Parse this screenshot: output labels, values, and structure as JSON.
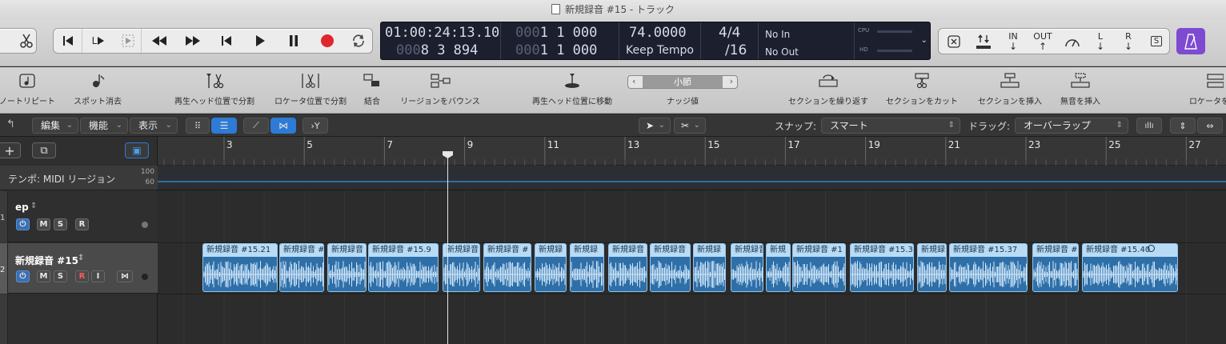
{
  "window_title": "新規録音 #15 - トラック",
  "transport": {
    "lcd": {
      "time_main": "01:00:24:13.10",
      "bars_left_dim": "000",
      "bars_left": "8 3 894",
      "pos1_dim": "000",
      "pos1": "1  1  000",
      "pos2_dim": "000",
      "pos2": "1  1  000",
      "tempo": "74.0000",
      "tempo_mode": "Keep Tempo",
      "sig_top": "4/4",
      "sig_bottom": "/16",
      "in_label": "No In",
      "out_label": "No Out",
      "cpu_label": "CPU",
      "hd_label": "HD"
    },
    "l_label": "L"
  },
  "right_controls": {
    "in_label": "IN",
    "out_label": "OUT",
    "l_label": "L",
    "r_label": "R",
    "s_label": "S"
  },
  "tools": [
    {
      "label": "ノートリピート"
    },
    {
      "label": "スポット消去"
    },
    {
      "label": "再生ヘッド位置で分割"
    },
    {
      "label": "ロケータ位置で分割"
    },
    {
      "label": "結合"
    },
    {
      "label": "リージョンをバウンス"
    },
    {
      "label": "再生ヘッド位置に移動"
    },
    {
      "label": "ナッジ値"
    },
    {
      "label": "セクションを繰り返す"
    },
    {
      "label": "セクションをカット"
    },
    {
      "label": "セクションを挿入"
    },
    {
      "label": "無音を挿入"
    },
    {
      "label": "ロケータを"
    }
  ],
  "nudge": {
    "value": "小節"
  },
  "editbar": {
    "edit_menu": "編集",
    "function_menu": "機能",
    "view_menu": "表示",
    "snap_label": "スナップ:",
    "snap_value": "スマート",
    "drag_label": "ドラッグ:",
    "drag_value": "オーバーラップ"
  },
  "ruler": {
    "bars": [
      "3",
      "5",
      "7",
      "9",
      "11",
      "13",
      "15",
      "17",
      "19",
      "21",
      "23",
      "25",
      "27"
    ]
  },
  "tempo_lane": {
    "label": "テンポ: MIDI リージョン",
    "max": "100",
    "min": "60"
  },
  "tracks": [
    {
      "number": "1",
      "name": "ep",
      "m": "M",
      "s": "S",
      "r": "R"
    },
    {
      "number": "2",
      "name": "新規録音 #15",
      "m": "M",
      "s": "S",
      "r": "R",
      "i": "I"
    }
  ],
  "regions": [
    "新規録音 #15.21",
    "新規録音 #",
    "新規録音",
    "新規録音 #15.9",
    "新規録音",
    "新規録音 #",
    "新規録",
    "新規録",
    "新規録音",
    "新規録音",
    "新規録",
    "新規録音",
    "新規",
    "新規録音 #1",
    "新規録音 #15.3",
    "新規録",
    "新規録音 #15.37",
    "新規録音 #",
    "新規録音 #15.40"
  ],
  "colors": {
    "region_fill": "#2f6fa8",
    "region_header": "#b9dcf6",
    "record_red": "#e0262d",
    "accent_blue": "#2d7bd6",
    "metronome_purple": "#7d4ad1"
  }
}
